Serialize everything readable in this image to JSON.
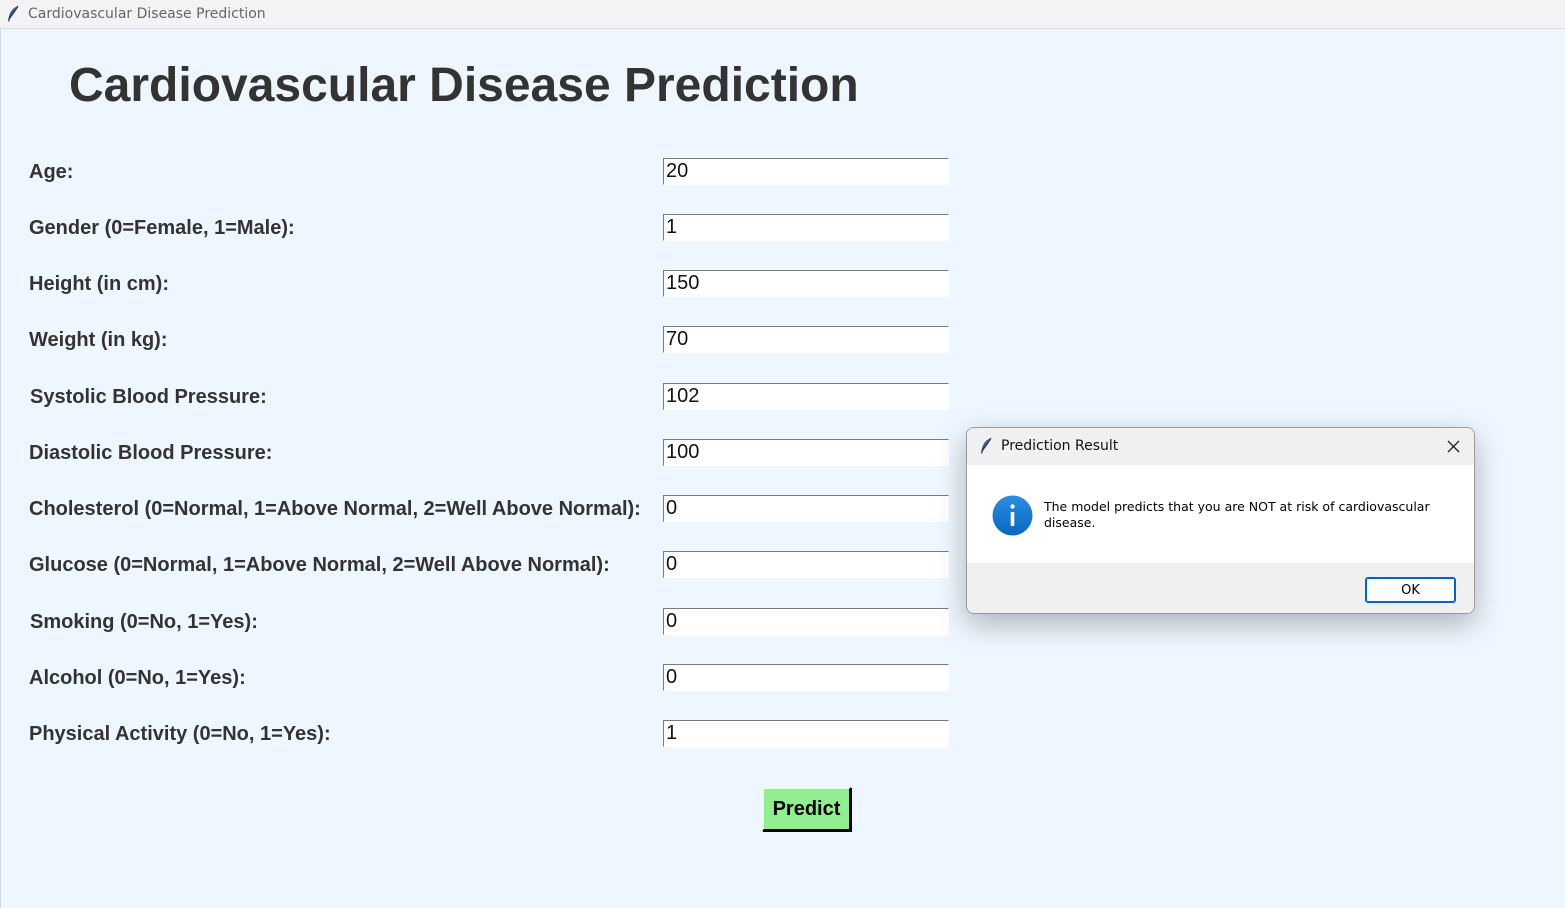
{
  "window": {
    "title": "Cardiovascular Disease Prediction",
    "icon": "feather-icon"
  },
  "heading": "Cardiovascular Disease Prediction",
  "fields": [
    {
      "label": "Age:",
      "value": "20"
    },
    {
      "label": "Gender (0=Female, 1=Male):",
      "value": "1"
    },
    {
      "label": "Height (in cm):",
      "value": "150"
    },
    {
      "label": "Weight (in kg):",
      "value": "70"
    },
    {
      "label": "Systolic Blood Pressure:",
      "value": "102"
    },
    {
      "label": "Diastolic Blood Pressure:",
      "value": "100"
    },
    {
      "label": "Cholesterol (0=Normal, 1=Above Normal, 2=Well Above Normal):",
      "value": "0"
    },
    {
      "label": "Glucose (0=Normal, 1=Above Normal, 2=Well Above Normal):",
      "value": "0"
    },
    {
      "label": "Smoking (0=No, 1=Yes):",
      "value": "0"
    },
    {
      "label": "Alcohol (0=No, 1=Yes):",
      "value": "0"
    },
    {
      "label": "Physical Activity (0=No, 1=Yes):",
      "value": "1"
    }
  ],
  "predict_button": {
    "label": "Predict",
    "color": "#90ee90"
  },
  "dialog": {
    "title": "Prediction Result",
    "message": "The model predicts that you are NOT at risk of cardiovascular disease.",
    "icon": "info-icon",
    "ok_label": "OK"
  },
  "colors": {
    "background": "#eef6ff",
    "heading": "#333333",
    "accent": "#0067c0",
    "info_icon": "#0a78d4"
  }
}
